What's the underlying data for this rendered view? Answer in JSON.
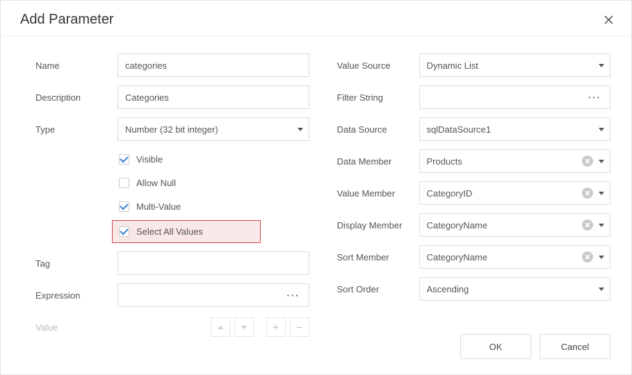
{
  "title": "Add Parameter",
  "left": {
    "name_label": "Name",
    "name_value": "categories",
    "description_label": "Description",
    "description_value": "Categories",
    "type_label": "Type",
    "type_value": "Number (32 bit integer)",
    "cb_visible": "Visible",
    "cb_allow_null": "Allow Null",
    "cb_multi_value": "Multi-Value",
    "cb_select_all": "Select All Values",
    "tag_label": "Tag",
    "tag_value": "",
    "expression_label": "Expression",
    "value_label": "Value"
  },
  "right": {
    "value_source_label": "Value Source",
    "value_source_value": "Dynamic List",
    "filter_string_label": "Filter String",
    "data_source_label": "Data Source",
    "data_source_value": "sqlDataSource1",
    "data_member_label": "Data Member",
    "data_member_value": "Products",
    "value_member_label": "Value Member",
    "value_member_value": "CategoryID",
    "display_member_label": "Display Member",
    "display_member_value": "CategoryName",
    "sort_member_label": "Sort Member",
    "sort_member_value": "CategoryName",
    "sort_order_label": "Sort Order",
    "sort_order_value": "Ascending"
  },
  "buttons": {
    "ok": "OK",
    "cancel": "Cancel"
  }
}
